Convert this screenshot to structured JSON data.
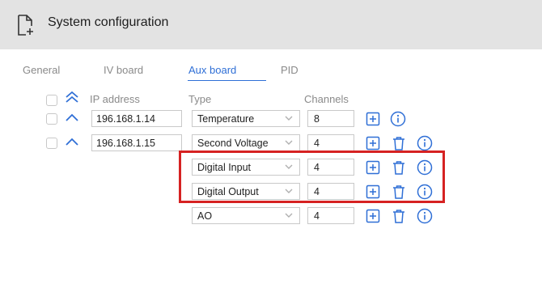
{
  "window": {
    "title": "System configuration",
    "title_icon": "file-plus-icon"
  },
  "tabs": [
    {
      "label": "General",
      "active": false
    },
    {
      "label": "IV board",
      "active": false
    },
    {
      "label": "Aux board",
      "active": true
    },
    {
      "label": "PID",
      "active": false
    }
  ],
  "table": {
    "headers": {
      "ip": "IP address",
      "type": "Type",
      "channels": "Channels"
    },
    "ip_rows": [
      {
        "ip": "196.168.1.14"
      },
      {
        "ip": "196.168.1.15"
      }
    ],
    "channel_rows": [
      {
        "type": "Temperature",
        "channels": "8"
      },
      {
        "type": "Second Voltage",
        "channels": "4"
      },
      {
        "type": "Digital Input",
        "channels": "4"
      },
      {
        "type": "Digital Output",
        "channels": "4"
      },
      {
        "type": "AO",
        "channels": "4"
      }
    ]
  },
  "colors": {
    "accent": "#2f6fd6",
    "highlight": "#d62222",
    "titlebar": "#e3e3e3"
  }
}
